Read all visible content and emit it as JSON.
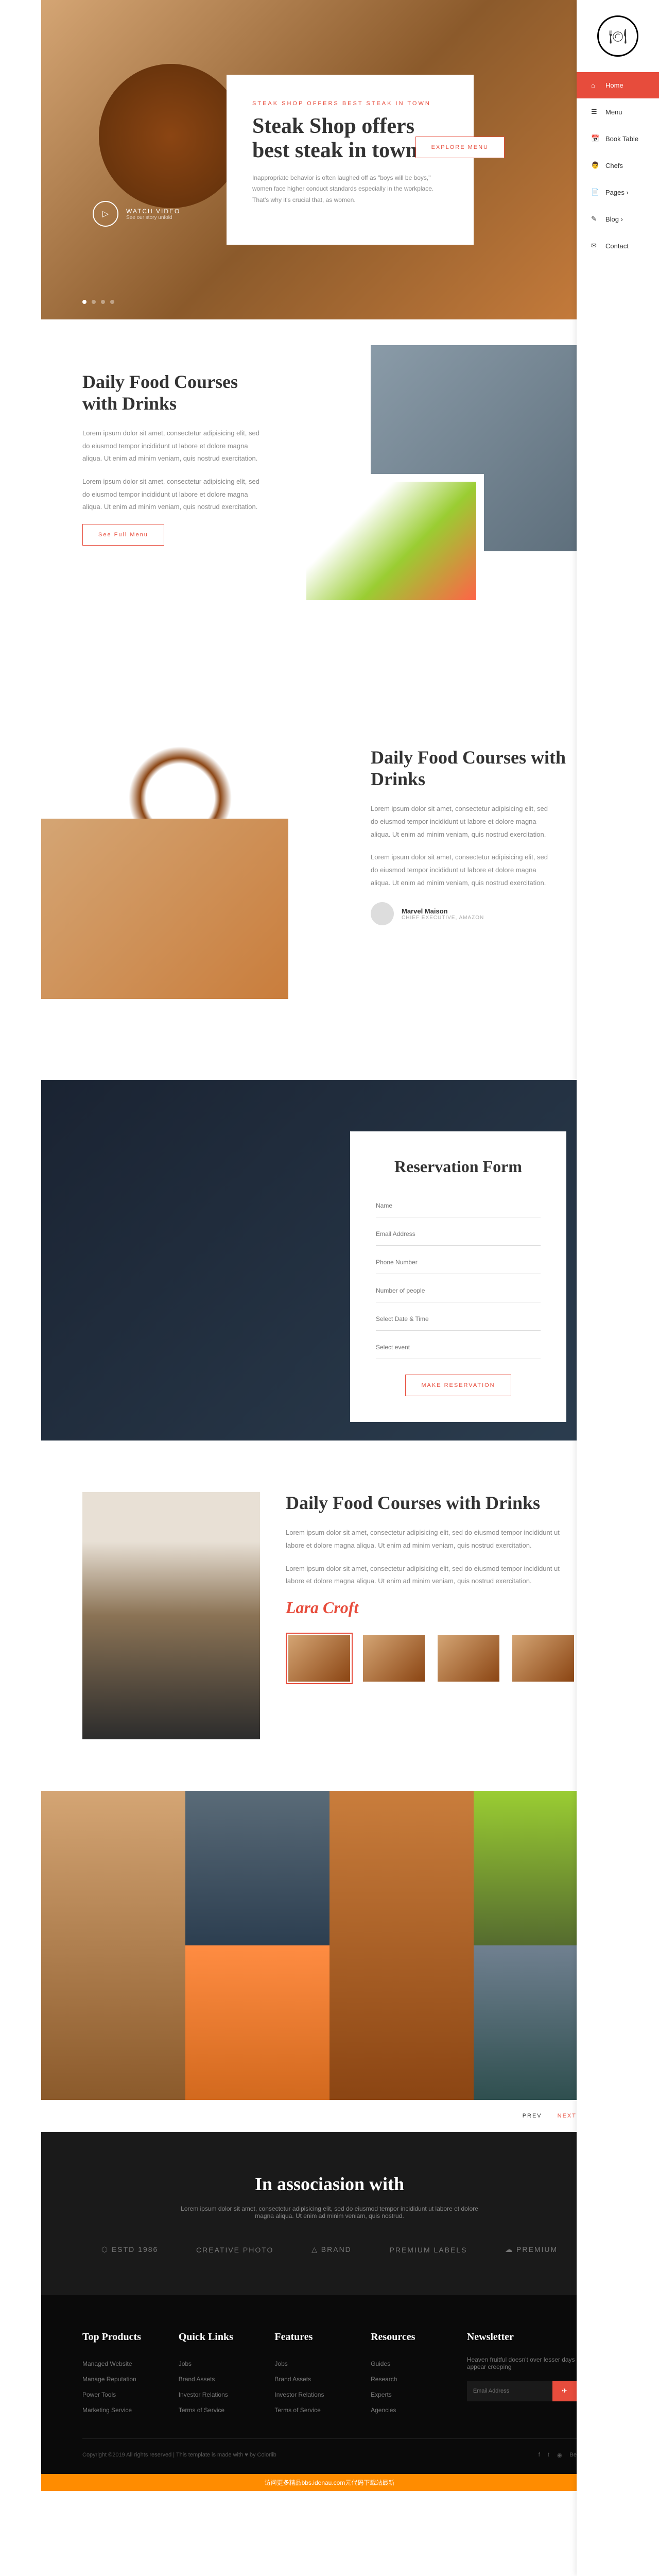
{
  "nav": {
    "items": [
      {
        "icon": "⌂",
        "label": "Home"
      },
      {
        "icon": "☰",
        "label": "Menu"
      },
      {
        "icon": "📅",
        "label": "Book Table"
      },
      {
        "icon": "👨",
        "label": "Chefs"
      },
      {
        "icon": "📄",
        "label": "Pages ›"
      },
      {
        "icon": "✎",
        "label": "Blog ›"
      },
      {
        "icon": "✉",
        "label": "Contact"
      }
    ]
  },
  "hero": {
    "tagline": "STEAK SHOP OFFERS BEST STEAK IN TOWN",
    "title": "Steak Shop offers best steak in town",
    "text": "Inappropriate behavior is often laughed off as \"boys will be boys,\" women face higher conduct standards especially in the workplace. That's why it's crucial that, as women.",
    "btn": "EXPLORE MENU",
    "watch": "WATCH VIDEO",
    "watch_sub": "See our story unfold"
  },
  "sec1": {
    "title": "Daily Food Courses with Drinks",
    "p1": "Lorem ipsum dolor sit amet, consectetur adipisicing elit, sed do eiusmod tempor incididunt ut labore et dolore magna aliqua. Ut enim ad minim veniam, quis nostrud exercitation.",
    "p2": "Lorem ipsum dolor sit amet, consectetur adipisicing elit, sed do eiusmod tempor incididunt ut labore et dolore magna aliqua. Ut enim ad minim veniam, quis nostrud exercitation.",
    "btn": "See Full Menu"
  },
  "sec2": {
    "title": "Daily Food Courses with Drinks",
    "p1": "Lorem ipsum dolor sit amet, consectetur adipisicing elit, sed do eiusmod tempor incididunt ut labore et dolore magna aliqua. Ut enim ad minim veniam, quis nostrud exercitation.",
    "p2": "Lorem ipsum dolor sit amet, consectetur adipisicing elit, sed do eiusmod tempor incididunt ut labore et dolore magna aliqua. Ut enim ad minim veniam, quis nostrud exercitation.",
    "author": "Marvel Maison",
    "role": "CHIEF EXECUTIVE, AMAZON"
  },
  "reserve": {
    "title": "Reservation Form",
    "fields": [
      "Name",
      "Email Address",
      "Phone Number",
      "Number of people",
      "Select Date & Time",
      "Select event"
    ],
    "btn": "MAKE RESERVATION"
  },
  "chef": {
    "title": "Daily Food Courses with Drinks",
    "p1": "Lorem ipsum dolor sit amet, consectetur adipisicing elit, sed do eiusmod tempor incididunt ut labore et dolore magna aliqua. Ut enim ad minim veniam, quis nostrud exercitation.",
    "p2": "Lorem ipsum dolor sit amet, consectetur adipisicing elit, sed do eiusmod tempor incididunt ut labore et dolore magna aliqua. Ut enim ad minim veniam, quis nostrud exercitation.",
    "sig": "Lara Croft"
  },
  "pager": {
    "prev": "PREV",
    "next": "NEXT"
  },
  "assoc": {
    "title": "In associasion with",
    "text": "Lorem ipsum dolor sit amet, consectetur adipisicing elit, sed do eiusmod tempor incididunt ut labore et dolore magna aliqua. Ut enim ad minim veniam, quis nostrud.",
    "brands": [
      "⬡ ESTD 1986",
      "CREATIVE PHOTO",
      "△ BRAND",
      "PREMIUM LABELS",
      "☁ PREMIUM"
    ]
  },
  "footer": {
    "cols": [
      {
        "title": "Top Products",
        "items": [
          "Managed Website",
          "Manage Reputation",
          "Power Tools",
          "Marketing Service"
        ]
      },
      {
        "title": "Quick Links",
        "items": [
          "Jobs",
          "Brand Assets",
          "Investor Relations",
          "Terms of Service"
        ]
      },
      {
        "title": "Features",
        "items": [
          "Jobs",
          "Brand Assets",
          "Investor Relations",
          "Terms of Service"
        ]
      },
      {
        "title": "Resources",
        "items": [
          "Guides",
          "Research",
          "Experts",
          "Agencies"
        ]
      }
    ],
    "newsletter": {
      "title": "Newsletter",
      "text": "Heaven fruitful doesn't over lesser days appear creeping",
      "placeholder": "Email Address"
    },
    "copyright": "Copyright ©2019 All rights reserved | This template is made with ♥ by Colorlib"
  },
  "banner": "访问更多精品bbs.idenau.com元代码下载站最新"
}
